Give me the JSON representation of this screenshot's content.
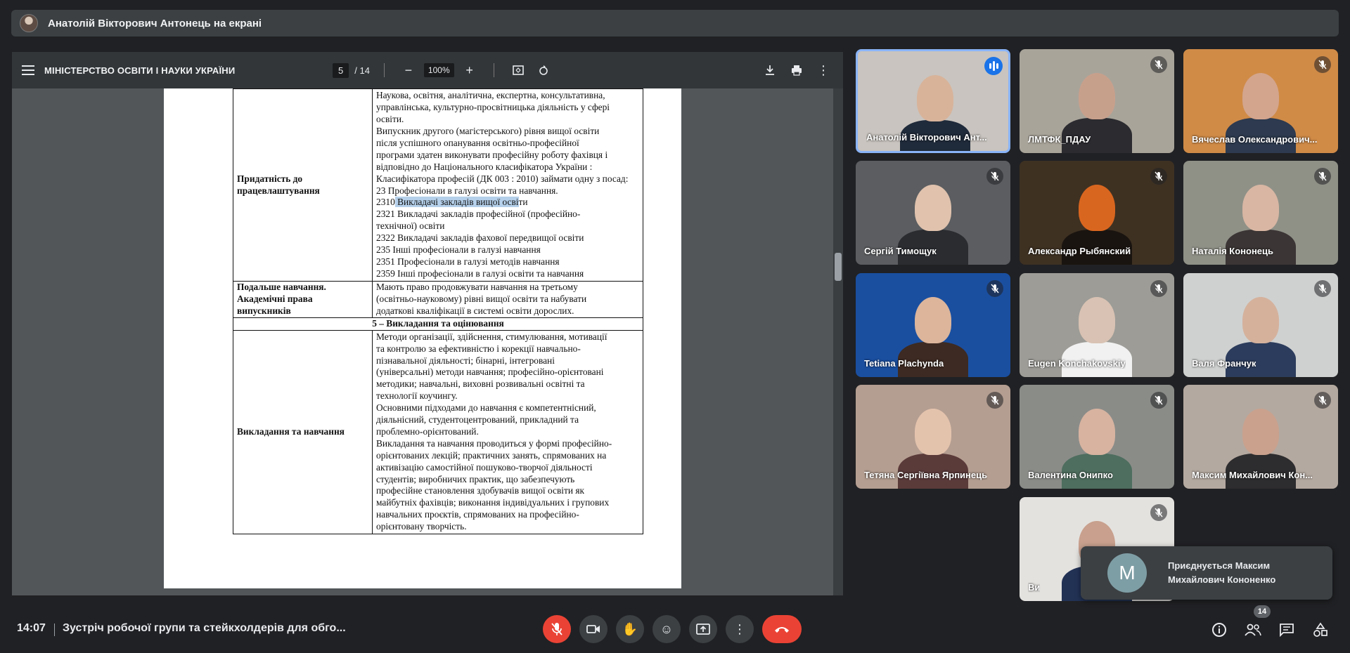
{
  "presenter": {
    "text": "Анатолій Вікторович Антонець на екрані"
  },
  "pdf": {
    "title": "МІНІСТЕРСТВО ОСВІТИ І НАУКИ УКРАЇНИ",
    "page_current": "5",
    "page_total": "/ 14",
    "zoom": "100%",
    "rows": [
      {
        "label": "Придатність до працевлаштування",
        "lines": [
          "Наукова, освітня, аналітична, експертна, консультативна,",
          "управлінська, культурно-просвітницька діяльність у сфері",
          "освіти.",
          "Випускник другого (магістерського) рівня вищої освіти",
          "після успішного опанування освітньо-професійної",
          "програми здатен виконувати професійну роботу фахівця і",
          "відповідно до Національного класифікатора України :",
          "Класифікатора професій (ДК 003 : 2010) займати одну з посад:",
          "23 Професіонали в галузі освіти та навчання.",
          "2310 Викладачі закладів вищої освіти",
          "2321 Викладачі закладів професійної (професійно-",
          "технічної) освіти",
          "2322 Викладачі закладів фахової передвищої освіти",
          "235 Інші професіонали в галузі навчання",
          "2351 Професіонали в галузі методів навчання",
          "2359 Інші професіонали в галузі освіти та навчання"
        ]
      },
      {
        "label": "Подальше навчання. Академічні права випускників",
        "lines": [
          "Мають право продовжувати навчання на третьому",
          "(освітньо-науковому) рівні вищої освіти та набувати",
          "додаткові кваліфікації в системі освіти дорослих."
        ]
      },
      {
        "section": "5 – Викладання та оцінювання"
      },
      {
        "label": "Викладання та навчання",
        "lines": [
          "Методи організації, здійснення, стимулювання, мотивації",
          "та контролю за ефективністю і корекції навчально-",
          "пізнавальної діяльності; бінарні, інтегровані",
          "(універсальні) методи навчання; професійно-орієнтовані",
          "методики; навчальні, виховні розвивальні освітні та",
          "технології коучингу.",
          "Основними підходами до навчання є компетентнісний,",
          "діяльнісний, студентоцентрований, прикладний та",
          "проблемно-орієнтований.",
          "Викладання та навчання проводиться у формі професійно-",
          "орієнтованих лекцій; практичних занять, спрямованих на",
          "активізацію самостійної пошуково-творчої діяльності",
          "студентів; виробничих практик, що забезпечують",
          "професійне становлення здобувачів вищої освіти як",
          "майбутніх фахівців; виконання індивідуальних і групових",
          "навчальних проєктів, спрямованих на професійно-",
          "орієнтовану творчість."
        ]
      }
    ],
    "highlight": {
      "row": 0,
      "line": 9,
      "prefix": "2310",
      "highlighted": " Викладачі закладів вищої осві",
      "suffix": "ти"
    }
  },
  "participants": [
    {
      "name": "Анатолій Вікторович Ант...",
      "speaking": true,
      "bg": "#c9c4bf",
      "skin": "#d8b39a",
      "shirt": "#1f2a3a"
    },
    {
      "name": "ЛМТФК_ПДАУ",
      "speaking": false,
      "bg": "#a9a49a",
      "skin": "#c7a08c",
      "shirt": "#2b2b30"
    },
    {
      "name": "Вячеслав Олександрович...",
      "speaking": false,
      "bg": "#d08b47",
      "skin": "#d3a58d",
      "shirt": "#2d3a4f"
    },
    {
      "name": "Сергій Тимощук",
      "speaking": false,
      "bg": "#5b5d60",
      "skin": "#e0c2ad",
      "shirt": "#2a2c30"
    },
    {
      "name": "Александр Рыбянский",
      "speaking": false,
      "bg": "#3e3122",
      "skin": "#d9661f",
      "shirt": "#1a1410"
    },
    {
      "name": "Наталія Кононець",
      "speaking": false,
      "bg": "#8f9187",
      "skin": "#d8b6a3",
      "shirt": "#3b3535"
    },
    {
      "name": "Tetiana Plachynda",
      "speaking": false,
      "bg": "#1a4fa0",
      "skin": "#dcb59b",
      "shirt": "#3d2a22"
    },
    {
      "name": "Eugen Konchakovskiy",
      "speaking": false,
      "bg": "#9d9c97",
      "skin": "#d9c2b3",
      "shirt": "#f1f1f1"
    },
    {
      "name": "Валя Франчук",
      "speaking": false,
      "bg": "#cfd1d0",
      "skin": "#d5b19c",
      "shirt": "#2c3c5c"
    },
    {
      "name": "Тетяна Сергіївна Ярпинець",
      "speaking": false,
      "bg": "#b49e91",
      "skin": "#e4c3ad",
      "shirt": "#5b3a3a"
    },
    {
      "name": "Валентина Онипко",
      "speaking": false,
      "bg": "#8a8c88",
      "skin": "#d7b3a0",
      "shirt": "#4e6e5f"
    },
    {
      "name": "Максим Михайлович Кон...",
      "speaking": false,
      "bg": "#b4a9a0",
      "skin": "#c9a18d",
      "shirt": "#2d2c2e"
    },
    {
      "name": "Ви",
      "speaking": false,
      "bg": "#e4e2df",
      "skin": "#c8a08d",
      "shirt": "#223255"
    }
  ],
  "toast": {
    "initial": "M",
    "line1": "Приєднується Максим",
    "line2": "Михайлович Кононенко"
  },
  "meeting": {
    "time": "14:07",
    "title": "Зустріч робочої групи та стейкхолдерів для обго...",
    "participant_count": "14"
  }
}
